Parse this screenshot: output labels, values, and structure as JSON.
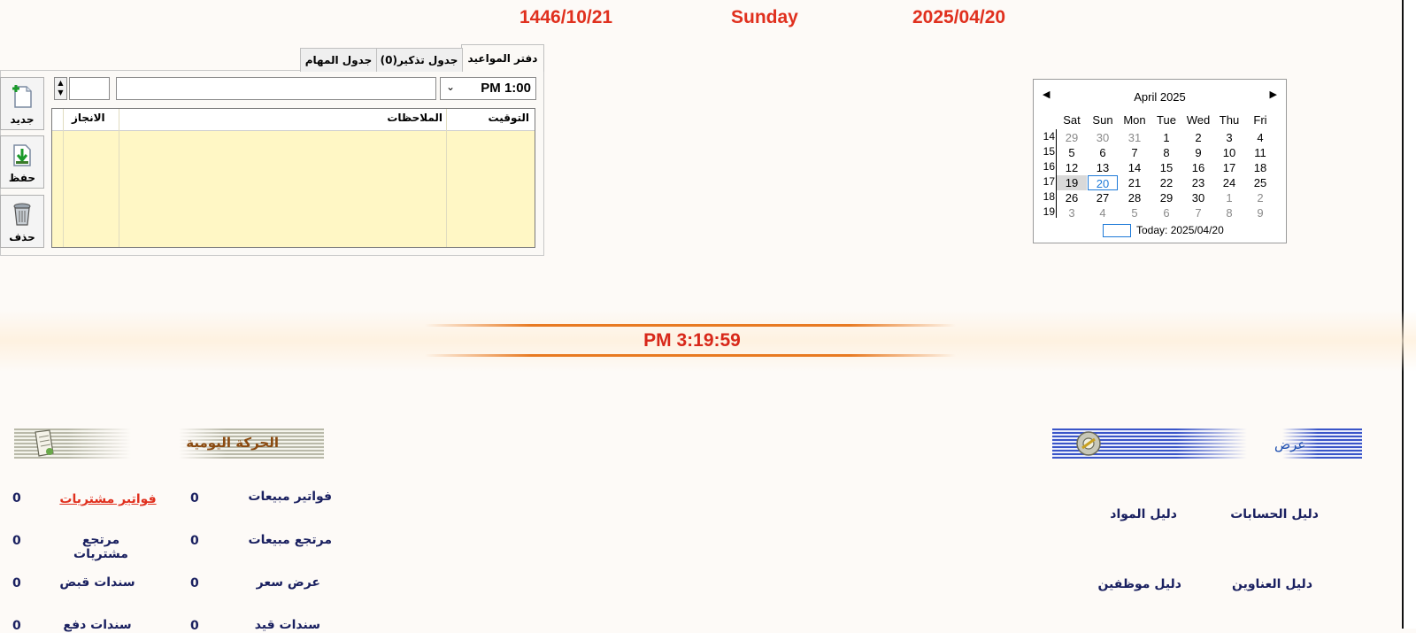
{
  "header": {
    "hijri_date": "1446/10/21",
    "weekday": "Sunday",
    "gregorian_date": "2025/04/20",
    "color": "#e0301e"
  },
  "appointments": {
    "tabs": [
      {
        "label": "دفتر المواعيد",
        "active": true
      },
      {
        "label": "جدول تذكير(0)",
        "active": false
      },
      {
        "label": "جدول المهام",
        "active": false
      }
    ],
    "time_value": "PM 1:00",
    "notes_value": "",
    "number_value": "",
    "columns": [
      "التوقيت",
      "الملاحظات",
      "الانجاز"
    ],
    "buttons": [
      {
        "label": "جديد",
        "icon": "new-document-icon"
      },
      {
        "label": "حفظ",
        "icon": "save-icon"
      },
      {
        "label": "حذف",
        "icon": "trash-icon"
      }
    ],
    "grid_color": "#fff7c5"
  },
  "calendar": {
    "title": "April 2025",
    "day_names": [
      "Sat",
      "Sun",
      "Mon",
      "Tue",
      "Wed",
      "Thu",
      "Fri"
    ],
    "weeks": [
      {
        "num": "14",
        "days": [
          "29",
          "30",
          "31",
          "1",
          "2",
          "3",
          "4"
        ],
        "dim": [
          true,
          true,
          true,
          false,
          false,
          false,
          false
        ]
      },
      {
        "num": "15",
        "days": [
          "5",
          "6",
          "7",
          "8",
          "9",
          "10",
          "11"
        ],
        "dim": [
          false,
          false,
          false,
          false,
          false,
          false,
          false
        ]
      },
      {
        "num": "16",
        "days": [
          "12",
          "13",
          "14",
          "15",
          "16",
          "17",
          "18"
        ],
        "dim": [
          false,
          false,
          false,
          false,
          false,
          false,
          false
        ]
      },
      {
        "num": "17",
        "days": [
          "19",
          "20",
          "21",
          "22",
          "23",
          "24",
          "25"
        ],
        "dim": [
          false,
          false,
          false,
          false,
          false,
          false,
          false
        ]
      },
      {
        "num": "18",
        "days": [
          "26",
          "27",
          "28",
          "29",
          "30",
          "1",
          "2"
        ],
        "dim": [
          false,
          false,
          false,
          false,
          false,
          true,
          true
        ]
      },
      {
        "num": "19",
        "days": [
          "3",
          "4",
          "5",
          "6",
          "7",
          "8",
          "9"
        ],
        "dim": [
          true,
          true,
          true,
          true,
          true,
          true,
          true
        ]
      }
    ],
    "selected_day": "19",
    "today_day": "20",
    "today_label": "Today: 2025/04/20",
    "accent": "#1e7ad8"
  },
  "clock": {
    "time": "PM 3:19:59",
    "color": "#d8281a"
  },
  "daily_movement": {
    "title": "الحركة اليومية",
    "title_color": "#8a4a10",
    "icon": "document-icon",
    "rows": [
      {
        "right_label": "فواتير مبيعات",
        "right_value": "0",
        "left_label": "فواتير مشتريات",
        "left_value": "0",
        "left_highlight": true
      },
      {
        "right_label": "مرتجع مبيعات",
        "right_value": "0",
        "left_label": "مرتجع مشتريات",
        "left_value": "0",
        "left_highlight": false
      },
      {
        "right_label": "عرض سعر",
        "right_value": "0",
        "left_label": "سندات قبض",
        "left_value": "0",
        "left_highlight": false
      },
      {
        "right_label": "سندات قيد",
        "right_value": "0",
        "left_label": "سندات دفع",
        "left_value": "0",
        "left_highlight": false
      }
    ],
    "highlight_color": "#e0301e"
  },
  "view_section": {
    "title": "عرض",
    "title_color": "#1e4fb0",
    "icon": "gear-icon",
    "links": [
      [
        "دليل الحسابات",
        "دليل المواد"
      ],
      [
        "دليل العناوين",
        "دليل موظفين"
      ]
    ]
  }
}
